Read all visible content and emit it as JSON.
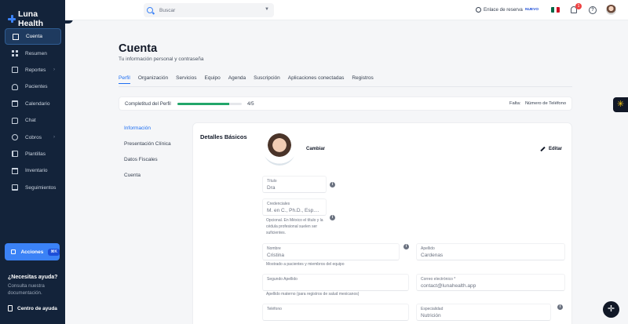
{
  "sidebar": {
    "brand": "Luna Health",
    "collapse_glyph": "‹",
    "items": [
      {
        "label": "Cuenta",
        "icon": "home-icon",
        "active": true
      },
      {
        "label": "Resumen",
        "icon": "grid-icon"
      },
      {
        "label": "Reportes",
        "icon": "report-icon",
        "has_submenu": true
      },
      {
        "label": "Pacientes",
        "icon": "users-icon"
      },
      {
        "label": "Calendario",
        "icon": "calendar-icon"
      },
      {
        "label": "Chat",
        "icon": "chat-icon"
      },
      {
        "label": "Cobros",
        "icon": "cash-icon",
        "has_submenu": true
      },
      {
        "label": "Plantillas",
        "icon": "template-icon"
      },
      {
        "label": "Inventario",
        "icon": "inventory-icon"
      },
      {
        "label": "Seguimientos",
        "icon": "tracking-icon"
      }
    ],
    "actions_label": "Acciones",
    "actions_shortcut": "⌘K",
    "help_title": "¿Necesitas ayuda?",
    "help_text": "Consulta nuestra documentación.",
    "help_center": "Centro de ayuda"
  },
  "topbar": {
    "search_placeholder": "Buscar",
    "booking_link": "Enlace de reserva",
    "new_badge": "NUEVO",
    "notifications_count": "1",
    "help_glyph": "?"
  },
  "page": {
    "title": "Cuenta",
    "subtitle": "Tu información personal y contraseña",
    "tabs": [
      "Perfil",
      "Organización",
      "Servicios",
      "Equipo",
      "Agenda",
      "Suscripción",
      "Aplicaciones conectadas",
      "Registros"
    ],
    "active_tab": 0
  },
  "progress": {
    "label": "Completitud del Perfil",
    "value": 0.8,
    "count_text": "4/5",
    "missing_label": "Falta:",
    "missing_value": "Número de Teléfono",
    "color": "#22a66a"
  },
  "subnav": [
    "Información",
    "Presentación Clínica",
    "Datos Fiscales",
    "Cuenta"
  ],
  "basic": {
    "title": "Detalles Básicos",
    "change_label": "Cambiar",
    "edit_label": "Editar",
    "fields": {
      "titulo": {
        "label": "Título",
        "value": "Dra"
      },
      "credenciales": {
        "label": "Credenciales",
        "placeholder": "M. en C., Ph.D., Esp....",
        "hint": "Opcional. En México el título y la cédula profesional suelen ser suficientes."
      },
      "nombre": {
        "label": "Nombre",
        "value": "Cristina",
        "hint": "Mostrado a pacientes y miembros del equipo"
      },
      "apellido": {
        "label": "Apellido",
        "value": "Cardenas"
      },
      "segundo_apellido": {
        "label": "Segundo Apellido",
        "hint": "Apellido materno (para registros de salud mexicanos)"
      },
      "correo": {
        "label": "Correo electrónico *",
        "value": "contact@lunahealth.app"
      },
      "telefono": {
        "label": "Teléfono"
      },
      "especialidad": {
        "label": "Especialidad",
        "value": "Nutrición"
      }
    }
  },
  "colors": {
    "sidebar_bg": "#13233a",
    "accent": "#1d6ef2",
    "flag_green": "#006847",
    "flag_white": "#ffffff",
    "flag_red": "#ce1126"
  },
  "widgets": {
    "side_glyph": "✳",
    "fab_glyph": "✛"
  }
}
